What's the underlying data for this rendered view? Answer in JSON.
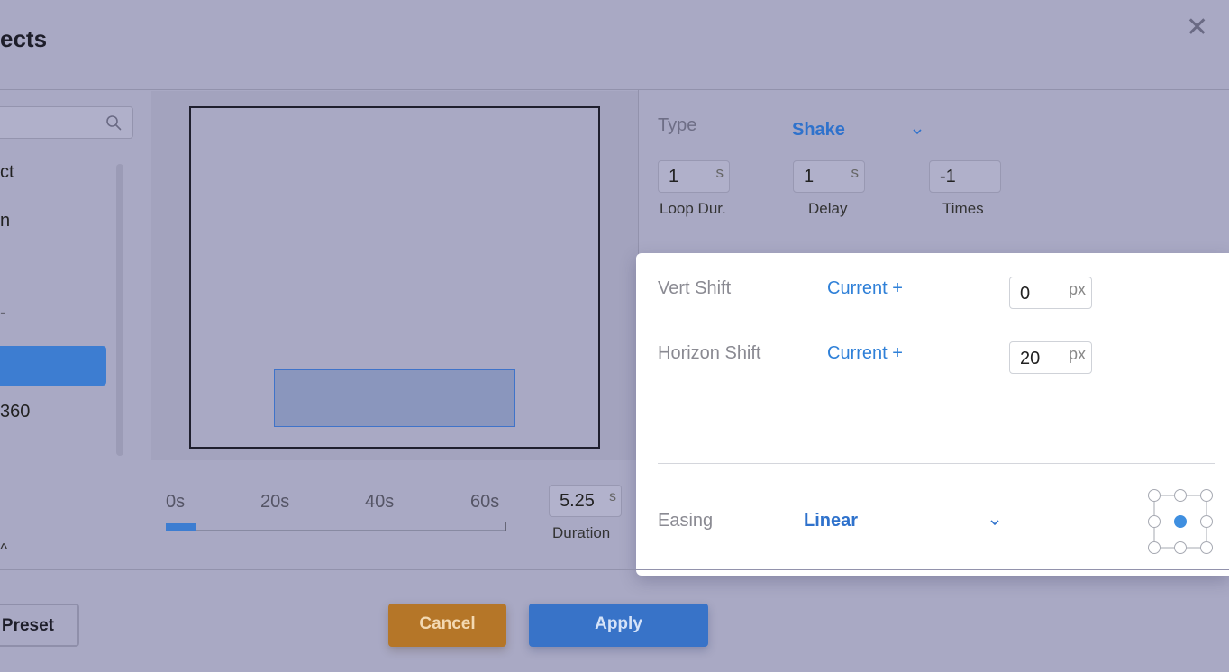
{
  "dialog": {
    "title": "ects",
    "close_glyph": "✕"
  },
  "left_list": {
    "items": [
      "ct",
      "n",
      "",
      "-",
      "",
      "360"
    ],
    "more_glyph": "^"
  },
  "timeline": {
    "ticks": [
      "0s",
      "20s",
      "40s",
      "60s"
    ],
    "duration_value": "5.25",
    "duration_unit": "s",
    "duration_label": "Duration",
    "progress": 0.09
  },
  "settings": {
    "type_label": "Type",
    "type_value": "Shake",
    "loop": {
      "value": "1",
      "unit": "s",
      "label": "Loop Dur."
    },
    "delay": {
      "value": "1",
      "unit": "s",
      "label": "Delay"
    },
    "times": {
      "value": "-1",
      "label": "Times"
    }
  },
  "panel": {
    "vert_shift": {
      "label": "Vert Shift",
      "mode": "Current +",
      "value": "0",
      "unit": "px"
    },
    "horizon_shift": {
      "label": "Horizon Shift",
      "mode": "Current +",
      "value": "20",
      "unit": "px"
    },
    "easing": {
      "label": "Easing",
      "value": "Linear"
    }
  },
  "footer": {
    "preset_label": "Preset",
    "cancel_label": "Cancel",
    "apply_label": "Apply"
  },
  "colors": {
    "backdrop": "#a9a9c4",
    "accent_blue": "#3873c8",
    "cancel_orange": "#b57628",
    "panel_white": "#ffffff"
  },
  "icons": [
    "search-icon",
    "close-icon",
    "chevron-down-icon",
    "anchor-grid-icon"
  ]
}
